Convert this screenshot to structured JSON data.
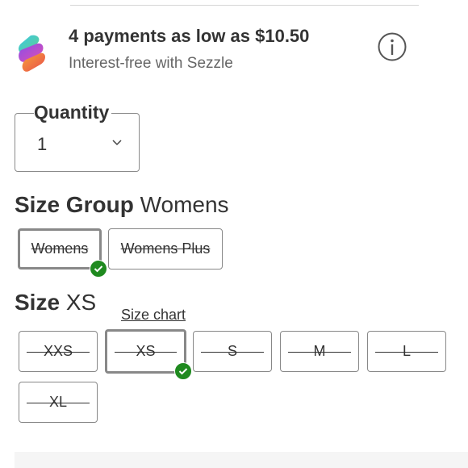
{
  "payment": {
    "title": "4 payments as low as $10.50",
    "subtitle": "Interest-free with Sezzle",
    "logo_icon": "sezzle-logo",
    "info_icon": "info-icon"
  },
  "quantity": {
    "label": "Quantity",
    "value": "1",
    "chevron_icon": "chevron-down-icon"
  },
  "size_group": {
    "label": "Size Group",
    "selected": "Womens",
    "options": [
      {
        "label": "Womens",
        "selected": true,
        "unavailable": true
      },
      {
        "label": "Womens Plus",
        "selected": false,
        "unavailable": true
      }
    ]
  },
  "size": {
    "label": "Size",
    "selected": "XS",
    "chart_link": "Size chart",
    "options": [
      {
        "label": "XXS",
        "selected": false,
        "unavailable": true
      },
      {
        "label": "XS",
        "selected": true,
        "unavailable": true
      },
      {
        "label": "S",
        "selected": false,
        "unavailable": true
      },
      {
        "label": "M",
        "selected": false,
        "unavailable": true
      },
      {
        "label": "L",
        "selected": false,
        "unavailable": true
      },
      {
        "label": "XL",
        "selected": false,
        "unavailable": true
      }
    ]
  },
  "colors": {
    "check_green": "#1f8a1f",
    "border_gray": "#888888",
    "panel_gray": "#f5f5f5"
  }
}
